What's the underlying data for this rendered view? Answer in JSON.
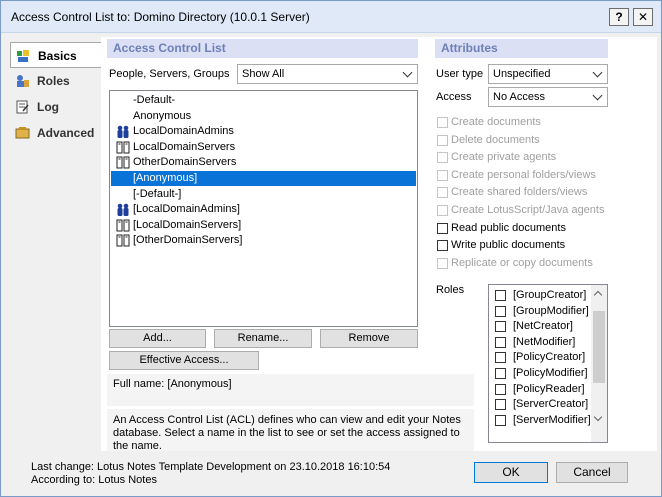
{
  "window": {
    "title": "Access Control List to: Domino Directory (10.0.1 Server)",
    "help_label": "?",
    "close_label": "✕"
  },
  "tabs": [
    {
      "label": "Basics",
      "icon": "basics-icon",
      "active": true
    },
    {
      "label": "Roles",
      "icon": "roles-icon",
      "active": false
    },
    {
      "label": "Log",
      "icon": "log-icon",
      "active": false
    },
    {
      "label": "Advanced",
      "icon": "advanced-icon",
      "active": false
    }
  ],
  "acl": {
    "header": "Access Control List",
    "filter_label": "People, Servers, Groups",
    "filter_value": "Show All",
    "names": [
      {
        "label": "-Default-",
        "icon": "none"
      },
      {
        "label": "Anonymous",
        "icon": "none"
      },
      {
        "label": "LocalDomainAdmins",
        "icon": "group-icon"
      },
      {
        "label": "LocalDomainServers",
        "icon": "server-group-icon"
      },
      {
        "label": "OtherDomainServers",
        "icon": "server-group-icon"
      },
      {
        "label": "[Anonymous]",
        "icon": "none",
        "selected": true
      },
      {
        "label": "[-Default-]",
        "icon": "none"
      },
      {
        "label": "[LocalDomainAdmins]",
        "icon": "group-icon"
      },
      {
        "label": "[LocalDomainServers]",
        "icon": "server-group-icon"
      },
      {
        "label": "[OtherDomainServers]",
        "icon": "server-group-icon"
      }
    ],
    "add_label": "Add...",
    "rename_label": "Rename...",
    "remove_label": "Remove",
    "effective_label": "Effective Access...",
    "full_name": "Full name: [Anonymous]",
    "description": "An Access Control List (ACL) defines who can view and edit your Notes database.  Select a name in the list to see or set the access assigned to the name."
  },
  "attributes": {
    "header": "Attributes",
    "user_type_label": "User type",
    "user_type_value": "Unspecified",
    "access_label": "Access",
    "access_value": "No Access",
    "options": [
      {
        "label": "Create documents",
        "enabled": false,
        "checked": false
      },
      {
        "label": "Delete documents",
        "enabled": false,
        "checked": false
      },
      {
        "label": "Create private agents",
        "enabled": false,
        "checked": false
      },
      {
        "label": "Create personal folders/views",
        "enabled": false,
        "checked": false
      },
      {
        "label": "Create shared folders/views",
        "enabled": false,
        "checked": false
      },
      {
        "label": "Create LotusScript/Java agents",
        "enabled": false,
        "checked": false
      },
      {
        "label": "Read public documents",
        "enabled": true,
        "checked": false
      },
      {
        "label": "Write public documents",
        "enabled": true,
        "checked": false
      },
      {
        "label": "Replicate or copy documents",
        "enabled": false,
        "checked": false
      }
    ],
    "roles_label": "Roles",
    "roles": [
      "[GroupCreator]",
      "[GroupModifier]",
      "[NetCreator]",
      "[NetModifier]",
      "[PolicyCreator]",
      "[PolicyModifier]",
      "[PolicyReader]",
      "[ServerCreator]",
      "[ServerModifier]"
    ]
  },
  "footer": {
    "last_change": "Last change: Lotus Notes Template Development on 23.10.2018 16:10:54",
    "according_to": "According to: Lotus Notes",
    "ok_label": "OK",
    "cancel_label": "Cancel"
  }
}
